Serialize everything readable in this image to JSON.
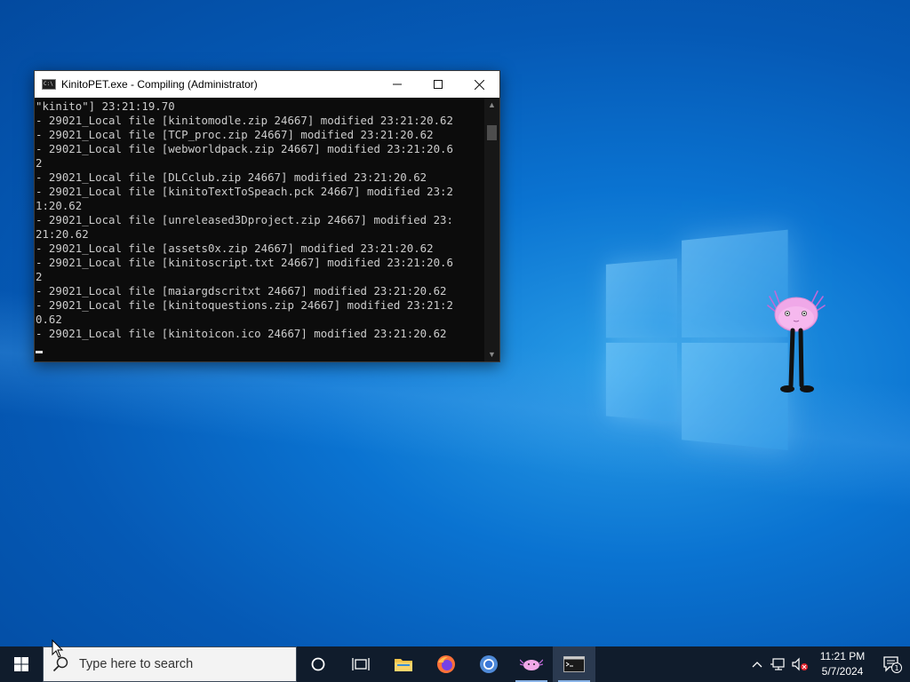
{
  "window": {
    "title": "KinitoPET.exe - Compiling (Administrator)",
    "controls": {
      "minimize": "—",
      "close": "✕"
    }
  },
  "console": {
    "lines": [
      "\"kinito\"] 23:21:19.70",
      "- 29021_Local file [kinitomodle.zip 24667] modified 23:21:20.62",
      "- 29021_Local file [TCP_proc.zip 24667] modified 23:21:20.62",
      "- 29021_Local file [webworldpack.zip 24667] modified 23:21:20.6",
      "2",
      "- 29021_Local file [DLCclub.zip 24667] modified 23:21:20.62",
      "- 29021_Local file [kinitoTextToSpeach.pck 24667] modified 23:2",
      "1:20.62",
      "- 29021_Local file [unreleased3Dproject.zip 24667] modified 23:",
      "21:20.62",
      "- 29021_Local file [assets0x.zip 24667] modified 23:21:20.62",
      "- 29021_Local file [kinitoscript.txt 24667] modified 23:21:20.6",
      "2",
      "- 29021_Local file [maiargdscritxt 24667] modified 23:21:20.62",
      "- 29021_Local file [kinitoquestions.zip 24667] modified 23:21:2",
      "0.62",
      "- 29021_Local file [kinitoicon.ico 24667] modified 23:21:20.62"
    ]
  },
  "taskbar": {
    "search_placeholder": "Type here to search",
    "apps": [
      "cortana-icon",
      "task-view-icon",
      "file-explorer-icon",
      "firefox-icon",
      "chrome-icon",
      "kinito-icon",
      "cmd-icon"
    ],
    "clock": {
      "time": "11:21 PM",
      "date": "5/7/2024"
    },
    "notification_count": "1"
  },
  "colors": {
    "taskbar": "#101c2c",
    "console_bg": "#0c0c0c",
    "console_text": "#cccccc",
    "desktop": "#0a73d1"
  }
}
